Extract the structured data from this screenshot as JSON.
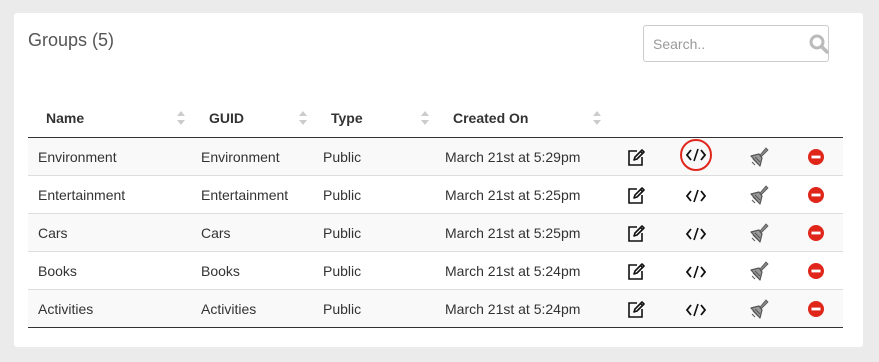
{
  "panel": {
    "title": "Groups (5)",
    "search": {
      "placeholder": "Search..",
      "value": ""
    }
  },
  "table": {
    "columns": [
      {
        "label": "Name",
        "sortable": true
      },
      {
        "label": "GUID",
        "sortable": true
      },
      {
        "label": "Type",
        "sortable": true
      },
      {
        "label": "Created On",
        "sortable": true
      }
    ],
    "rows": [
      {
        "name": "Environment",
        "guid": "Environment",
        "type": "Public",
        "created": "March 21st at 5:29pm",
        "highlight_embed": true
      },
      {
        "name": "Entertainment",
        "guid": "Entertainment",
        "type": "Public",
        "created": "March 21st at 5:25pm",
        "highlight_embed": false
      },
      {
        "name": "Cars",
        "guid": "Cars",
        "type": "Public",
        "created": "March 21st at 5:25pm",
        "highlight_embed": false
      },
      {
        "name": "Books",
        "guid": "Books",
        "type": "Public",
        "created": "March 21st at 5:24pm",
        "highlight_embed": false
      },
      {
        "name": "Activities",
        "guid": "Activities",
        "type": "Public",
        "created": "March 21st at 5:24pm",
        "highlight_embed": false
      }
    ],
    "row_actions": [
      "edit-icon",
      "embed-code-icon",
      "clean-brush-icon",
      "delete-icon"
    ]
  },
  "colors": {
    "delete": "#e0261b",
    "highlight_ring": "#e0261b",
    "background": "#ebebeb"
  }
}
